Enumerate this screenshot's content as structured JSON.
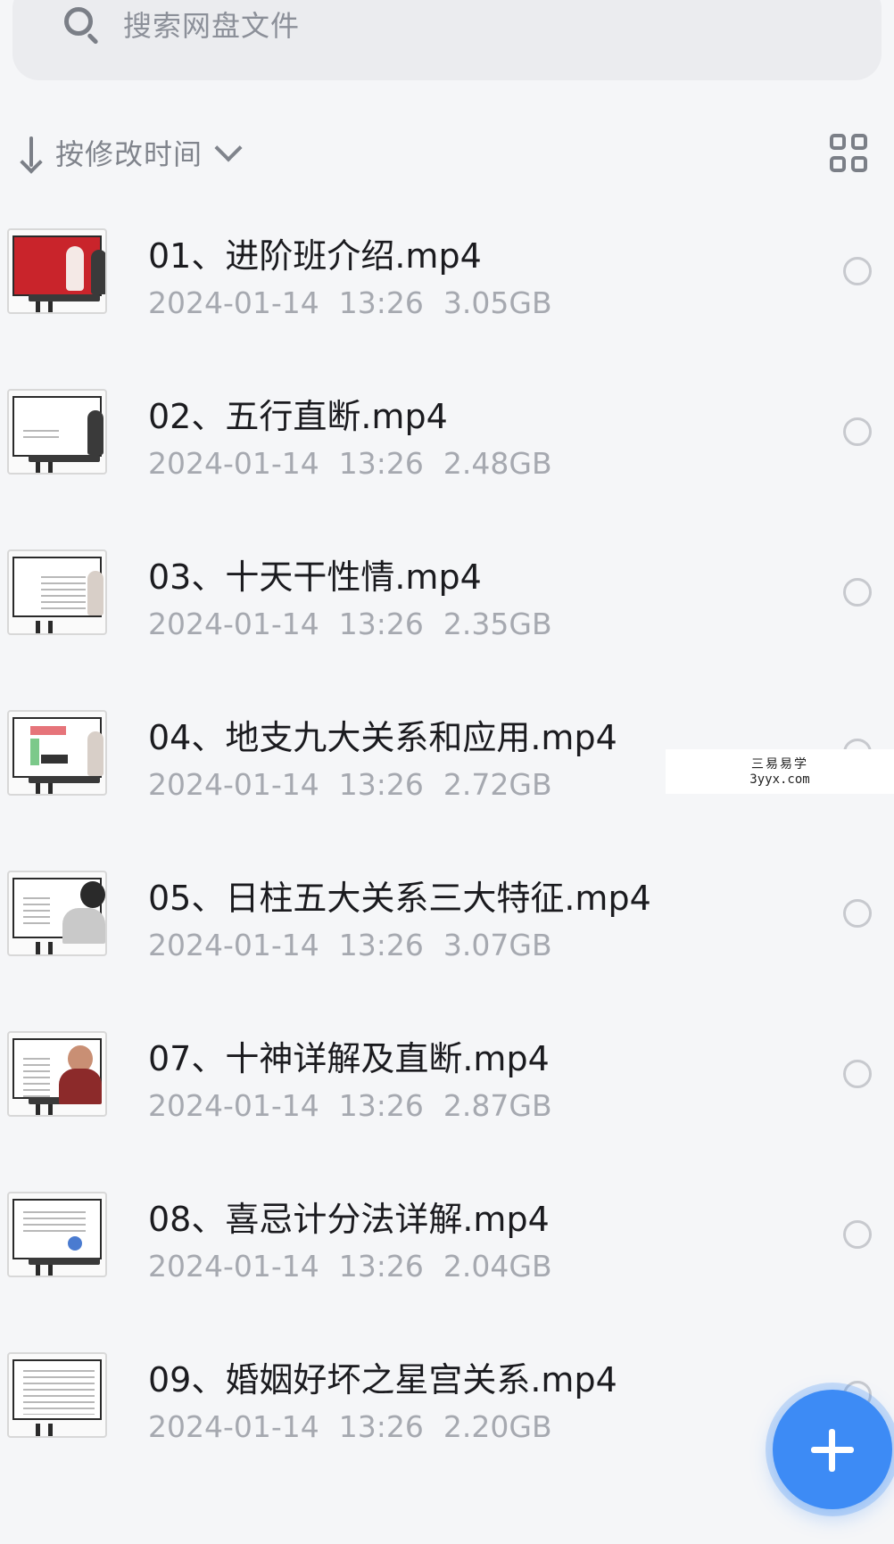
{
  "search": {
    "placeholder": "搜索网盘文件"
  },
  "sort": {
    "label": "按修改时间"
  },
  "files": [
    {
      "name": "01、进阶班介绍.mp4",
      "date": "2024-01-14",
      "time": "13:26",
      "size": "3.05GB"
    },
    {
      "name": "02、五行直断.mp4",
      "date": "2024-01-14",
      "time": "13:26",
      "size": "2.48GB"
    },
    {
      "name": "03、十天干性情.mp4",
      "date": "2024-01-14",
      "time": "13:26",
      "size": "2.35GB"
    },
    {
      "name": "04、地支九大关系和应用.mp4",
      "date": "2024-01-14",
      "time": "13:26",
      "size": "2.72GB"
    },
    {
      "name": "05、日柱五大关系三大特征.mp4",
      "date": "2024-01-14",
      "time": "13:26",
      "size": "3.07GB"
    },
    {
      "name": "07、十神详解及直断.mp4",
      "date": "2024-01-14",
      "time": "13:26",
      "size": "2.87GB"
    },
    {
      "name": "08、喜忌计分法详解.mp4",
      "date": "2024-01-14",
      "time": "13:26",
      "size": "2.04GB"
    },
    {
      "name": "09、婚姻好坏之星宫关系.mp4",
      "date": "2024-01-14",
      "time": "13:26",
      "size": "2.20GB"
    }
  ],
  "watermark": {
    "title": "三易易学",
    "url": "3yyx.com"
  },
  "icons": {
    "search": "search-icon",
    "sort": "sort-arrow-icon",
    "dropdown": "chevron-down-icon",
    "view": "grid-view-icon",
    "add": "plus-icon"
  },
  "colors": {
    "accent": "#3d8bf5",
    "background": "#f5f6f8",
    "text": "#1b1b1f",
    "meta": "#a6a9b0"
  }
}
